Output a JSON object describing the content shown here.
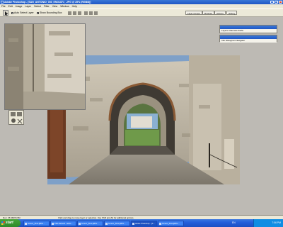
{
  "window": {
    "title": "Adobe Photoshop - [SAN_ANTONIO_003_ENG1871_.JPG @ 25% (RGB/8)]"
  },
  "menu": [
    "File",
    "Edit",
    "Image",
    "Layer",
    "Select",
    "Filter",
    "View",
    "Window",
    "Help"
  ],
  "options": {
    "auto_select": "Auto Select Layer",
    "show_bounding": "Show Bounding Box"
  },
  "palette_tabs": [
    "Layer Comps",
    "Brushes",
    "Actions",
    "History"
  ],
  "panels": {
    "layers": {
      "tabs": "Layers Channels Paths"
    },
    "navigator": {
      "tabs": "Info Histogram Navigator"
    }
  },
  "status": {
    "doc": "Doc: 15.9M/15.9M",
    "hint": "Click and drag to move layer or selection. Use Shift and Alt for additional options."
  },
  "taskbar": {
    "start": "start",
    "tasks": [
      "Screen_Shot-[RPG...",
      "PDF-Refresh - Edito...",
      "Screen_Shot-[RPG...",
      "Screen_Shot-[RPG...",
      "Adobe Photoshop - [S...",
      "Screen_Shot-[RPG..."
    ],
    "tray_label": "EN",
    "clock": "7:06 PM"
  },
  "icons": {
    "app": "photoshop-icon",
    "move_tool": "move-tool-icon",
    "start": "windows-logo-icon"
  },
  "colors": {
    "titlebar": "#2a63c8",
    "taskbar": "#245edb",
    "start_button": "#3a9a31",
    "workspace": "#bdbab4"
  }
}
